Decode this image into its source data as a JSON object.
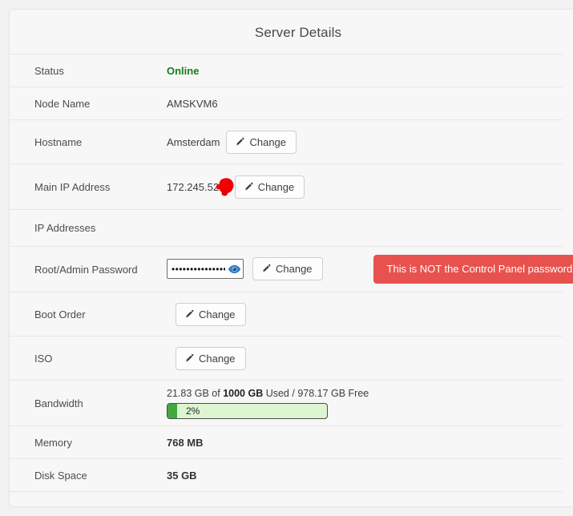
{
  "panel": {
    "title": "Server Details"
  },
  "buttons": {
    "change_label": "Change",
    "pencil_icon": "pencil-icon",
    "eye_icon": "eye-icon"
  },
  "warning": {
    "label": "This is NOT the Control Panel password",
    "color": "#e8524e"
  },
  "colors": {
    "status_online": "#1a7a1a",
    "progress_fill": "#3fa93f",
    "progress_track": "#ddf5d2",
    "redaction": "#f00000"
  },
  "rows": {
    "status": {
      "label": "Status",
      "value": "Online"
    },
    "node_name": {
      "label": "Node Name",
      "value": "AMSKVM6"
    },
    "hostname": {
      "label": "Hostname",
      "value": "Amsterdam"
    },
    "main_ip": {
      "label": "Main IP Address",
      "value": "172.245.52."
    },
    "ip_addresses": {
      "label": "IP Addresses",
      "value": ""
    },
    "root_password": {
      "label": "Root/Admin Password",
      "masked_value": "••••••••••••••••"
    },
    "boot_order": {
      "label": "Boot Order"
    },
    "iso": {
      "label": "ISO"
    },
    "bandwidth": {
      "label": "Bandwidth",
      "used": "21.83 GB",
      "of_word": " of ",
      "total": "1000 GB",
      "used_word": " Used / ",
      "free": "978.17 GB Free",
      "percent_label": "2%",
      "percent_value": 2
    },
    "memory": {
      "label": "Memory",
      "value": "768 MB"
    },
    "disk_space": {
      "label": "Disk Space",
      "value": "35 GB"
    }
  }
}
